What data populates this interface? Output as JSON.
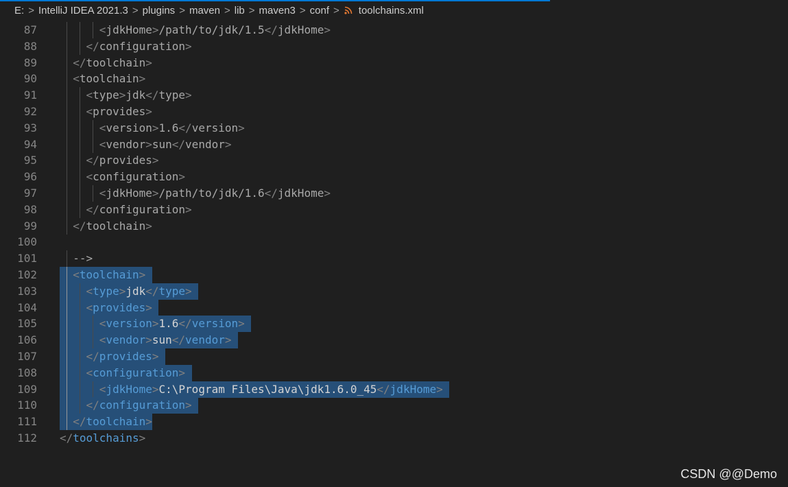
{
  "breadcrumb": {
    "items": [
      "E:",
      "IntelliJ IDEA 2021.3",
      "plugins",
      "maven",
      "lib",
      "maven3",
      "conf"
    ],
    "file": "toolchains.xml",
    "file_icon": "rss-xml-icon",
    "separator": ">"
  },
  "editor": {
    "line_numbers": [
      "87",
      "88",
      "89",
      "90",
      "91",
      "92",
      "93",
      "94",
      "95",
      "96",
      "97",
      "98",
      "99",
      "100",
      "101",
      "102",
      "103",
      "104",
      "105",
      "106",
      "107",
      "108",
      "109",
      "110",
      "111",
      "112"
    ],
    "lines": [
      {
        "indent": "      ",
        "parts": [
          [
            "pun",
            "<"
          ],
          [
            "plain",
            "jdkHome"
          ],
          [
            "pun",
            ">"
          ],
          [
            "plain",
            "/path/to/jdk/1.5"
          ],
          [
            "pun",
            "</"
          ],
          [
            "plain",
            "jdkHome"
          ],
          [
            "pun",
            ">"
          ]
        ]
      },
      {
        "indent": "    ",
        "parts": [
          [
            "pun",
            "</"
          ],
          [
            "plain",
            "configuration"
          ],
          [
            "pun",
            ">"
          ]
        ]
      },
      {
        "indent": "  ",
        "parts": [
          [
            "pun",
            "</"
          ],
          [
            "plain",
            "toolchain"
          ],
          [
            "pun",
            ">"
          ]
        ]
      },
      {
        "indent": "  ",
        "parts": [
          [
            "pun",
            "<"
          ],
          [
            "plain",
            "toolchain"
          ],
          [
            "pun",
            ">"
          ]
        ]
      },
      {
        "indent": "    ",
        "parts": [
          [
            "pun",
            "<"
          ],
          [
            "plain",
            "type"
          ],
          [
            "pun",
            ">"
          ],
          [
            "plain",
            "jdk"
          ],
          [
            "pun",
            "</"
          ],
          [
            "plain",
            "type"
          ],
          [
            "pun",
            ">"
          ]
        ]
      },
      {
        "indent": "    ",
        "parts": [
          [
            "pun",
            "<"
          ],
          [
            "plain",
            "provides"
          ],
          [
            "pun",
            ">"
          ]
        ]
      },
      {
        "indent": "      ",
        "parts": [
          [
            "pun",
            "<"
          ],
          [
            "plain",
            "version"
          ],
          [
            "pun",
            ">"
          ],
          [
            "plain",
            "1.6"
          ],
          [
            "pun",
            "</"
          ],
          [
            "plain",
            "version"
          ],
          [
            "pun",
            ">"
          ]
        ]
      },
      {
        "indent": "      ",
        "parts": [
          [
            "pun",
            "<"
          ],
          [
            "plain",
            "vendor"
          ],
          [
            "pun",
            ">"
          ],
          [
            "plain",
            "sun"
          ],
          [
            "pun",
            "</"
          ],
          [
            "plain",
            "vendor"
          ],
          [
            "pun",
            ">"
          ]
        ]
      },
      {
        "indent": "    ",
        "parts": [
          [
            "pun",
            "</"
          ],
          [
            "plain",
            "provides"
          ],
          [
            "pun",
            ">"
          ]
        ]
      },
      {
        "indent": "    ",
        "parts": [
          [
            "pun",
            "<"
          ],
          [
            "plain",
            "configuration"
          ],
          [
            "pun",
            ">"
          ]
        ]
      },
      {
        "indent": "      ",
        "parts": [
          [
            "pun",
            "<"
          ],
          [
            "plain",
            "jdkHome"
          ],
          [
            "pun",
            ">"
          ],
          [
            "plain",
            "/path/to/jdk/1.6"
          ],
          [
            "pun",
            "</"
          ],
          [
            "plain",
            "jdkHome"
          ],
          [
            "pun",
            ">"
          ]
        ]
      },
      {
        "indent": "    ",
        "parts": [
          [
            "pun",
            "</"
          ],
          [
            "plain",
            "configuration"
          ],
          [
            "pun",
            ">"
          ]
        ]
      },
      {
        "indent": "  ",
        "parts": [
          [
            "pun",
            "</"
          ],
          [
            "plain",
            "toolchain"
          ],
          [
            "pun",
            ">"
          ]
        ]
      },
      {
        "indent": "",
        "parts": []
      },
      {
        "indent": "  ",
        "parts": [
          [
            "plain",
            "-->"
          ]
        ]
      },
      {
        "indent": "  ",
        "sel": 14,
        "parts": [
          [
            "pun",
            "<"
          ],
          [
            "tag",
            "toolchain"
          ],
          [
            "pun",
            ">"
          ]
        ]
      },
      {
        "indent": "    ",
        "sel": 21,
        "parts": [
          [
            "pun",
            "<"
          ],
          [
            "tag",
            "type"
          ],
          [
            "pun",
            ">"
          ],
          [
            "txt",
            "jdk"
          ],
          [
            "pun",
            "</"
          ],
          [
            "tag",
            "type"
          ],
          [
            "pun",
            ">"
          ]
        ]
      },
      {
        "indent": "    ",
        "sel": 15,
        "parts": [
          [
            "pun",
            "<"
          ],
          [
            "tag",
            "provides"
          ],
          [
            "pun",
            ">"
          ]
        ]
      },
      {
        "indent": "      ",
        "sel": 29,
        "parts": [
          [
            "pun",
            "<"
          ],
          [
            "tag",
            "version"
          ],
          [
            "pun",
            ">"
          ],
          [
            "txt",
            "1.6"
          ],
          [
            "pun",
            "</"
          ],
          [
            "tag",
            "version"
          ],
          [
            "pun",
            ">"
          ]
        ]
      },
      {
        "indent": "      ",
        "sel": 27,
        "parts": [
          [
            "pun",
            "<"
          ],
          [
            "tag",
            "vendor"
          ],
          [
            "pun",
            ">"
          ],
          [
            "txt",
            "sun"
          ],
          [
            "pun",
            "</"
          ],
          [
            "tag",
            "vendor"
          ],
          [
            "pun",
            ">"
          ]
        ]
      },
      {
        "indent": "    ",
        "sel": 16,
        "parts": [
          [
            "pun",
            "</"
          ],
          [
            "tag",
            "provides"
          ],
          [
            "pun",
            ">"
          ]
        ]
      },
      {
        "indent": "    ",
        "sel": 20,
        "parts": [
          [
            "pun",
            "<"
          ],
          [
            "tag",
            "configuration"
          ],
          [
            "pun",
            ">"
          ]
        ]
      },
      {
        "indent": "      ",
        "sel": 59,
        "parts": [
          [
            "pun",
            "<"
          ],
          [
            "tag",
            "jdkHome"
          ],
          [
            "pun",
            ">"
          ],
          [
            "txt",
            "C:\\Program Files\\Java\\jdk1.6.0_45"
          ],
          [
            "pun",
            "</"
          ],
          [
            "tag",
            "jdkHome"
          ],
          [
            "pun",
            ">"
          ]
        ]
      },
      {
        "indent": "    ",
        "sel": 21,
        "parts": [
          [
            "pun",
            "</"
          ],
          [
            "tag",
            "configuration"
          ],
          [
            "pun",
            ">"
          ]
        ]
      },
      {
        "indent": "  ",
        "sel": 14,
        "parts": [
          [
            "pun",
            "</"
          ],
          [
            "tag",
            "toolchain"
          ],
          [
            "pun",
            ">"
          ]
        ]
      },
      {
        "indent": "",
        "parts": [
          [
            "pun",
            "</"
          ],
          [
            "tag",
            "toolchains"
          ],
          [
            "pun",
            ">"
          ]
        ]
      }
    ]
  },
  "colors": {
    "background": "#1f1f1f",
    "selection": "#264f78",
    "tag": "#569cd6",
    "punctuation": "#808080",
    "line_number": "#858585",
    "rss_icon": "#e37933"
  },
  "watermark": "CSDN @@Demo"
}
